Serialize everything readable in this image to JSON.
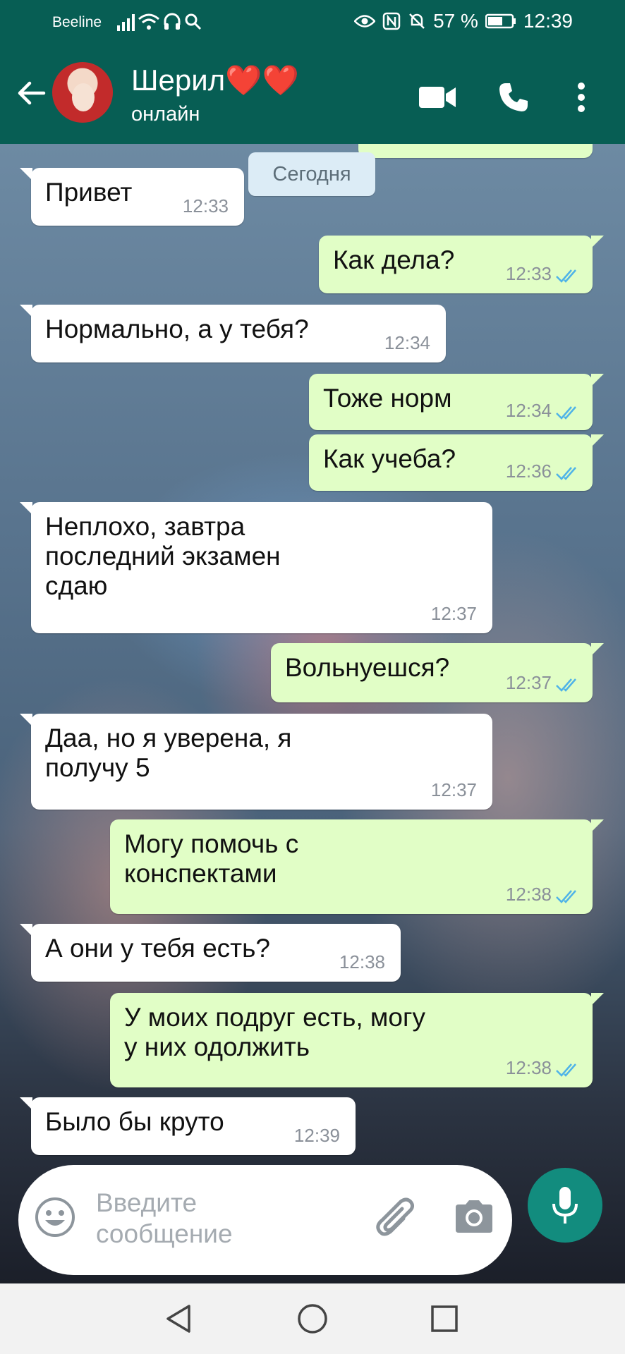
{
  "status_bar": {
    "carrier": "Beeline",
    "battery": "57 %",
    "time": "12:39"
  },
  "header": {
    "contact_name": "Шерил❤️❤️",
    "contact_status": "онлайн"
  },
  "chat": {
    "date_chip": "Сегодня",
    "messages": [
      {
        "dir": "in",
        "text": "Привет",
        "time": "12:33"
      },
      {
        "dir": "out",
        "text": "Как дела?",
        "time": "12:33"
      },
      {
        "dir": "in",
        "text": "Нормально, а у тебя?",
        "time": "12:34"
      },
      {
        "dir": "out",
        "text": "Тоже норм",
        "time": "12:34"
      },
      {
        "dir": "out",
        "text": "Как учеба?",
        "time": "12:36"
      },
      {
        "dir": "in",
        "text": "Неплохо, завтра\nпоследний экзамен\nсдаю",
        "time": "12:37"
      },
      {
        "dir": "out",
        "text": "Вольнуешся?",
        "time": "12:37"
      },
      {
        "dir": "in",
        "text": "Даа, но я уверена, я\nполучу 5",
        "time": "12:37"
      },
      {
        "dir": "out",
        "text": "Могу помочь с\nконспектами",
        "time": "12:38"
      },
      {
        "dir": "in",
        "text": "А они у тебя есть?",
        "time": "12:38"
      },
      {
        "dir": "out",
        "text": "У моих подруг есть, могу\nу них одолжить",
        "time": "12:38"
      },
      {
        "dir": "in",
        "text": "Было бы круто",
        "time": "12:39"
      }
    ]
  },
  "input": {
    "placeholder": "Введите\nсообщение"
  },
  "colors": {
    "header": "#075e54",
    "outgoing_bubble": "#e1fec6",
    "incoming_bubble": "#ffffff",
    "mic_button": "#128c7e",
    "read_ticks": "#4fb3e8"
  },
  "icons": [
    "back-arrow-icon",
    "video-call-icon",
    "phone-icon",
    "more-vert-icon",
    "emoji-icon",
    "attach-icon",
    "camera-icon",
    "mic-icon",
    "nav-back-icon",
    "nav-home-icon",
    "nav-recents-icon"
  ]
}
